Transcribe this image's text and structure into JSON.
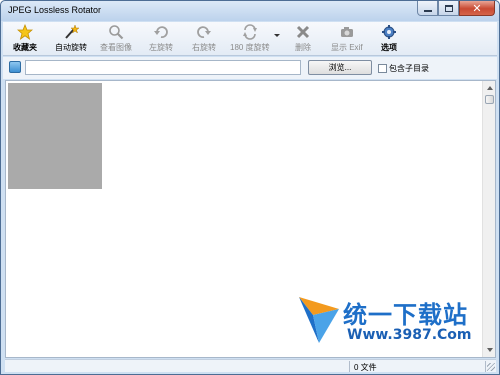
{
  "window": {
    "title": "JPEG Lossless Rotator"
  },
  "toolbar": {
    "items": [
      {
        "label": "收藏夹",
        "icon": "star-icon",
        "enabled": true
      },
      {
        "label": "自动旋转",
        "icon": "magic-wand-icon",
        "enabled": true
      },
      {
        "label": "查看图像",
        "icon": "magnifier-icon",
        "enabled": false
      },
      {
        "label": "左旋转",
        "icon": "rotate-left-icon",
        "enabled": false
      },
      {
        "label": "右旋转",
        "icon": "rotate-right-icon",
        "enabled": false
      },
      {
        "label": "180 度旋转",
        "icon": "rotate-180-icon",
        "enabled": false
      },
      {
        "label": "删除",
        "icon": "delete-icon",
        "enabled": false
      },
      {
        "label": "显示 Exif",
        "icon": "camera-icon",
        "enabled": false
      },
      {
        "label": "选项",
        "icon": "options-icon",
        "enabled": true
      }
    ]
  },
  "pathbar": {
    "path_value": "",
    "browse_label": "浏览...",
    "include_subdirs_label": "包含子目录",
    "include_subdirs_checked": false
  },
  "watermark": {
    "brand": "统一下载站",
    "url": "Www.3987.Com"
  },
  "status": {
    "file_count": "0 文件"
  },
  "colors": {
    "chrome": "#cfe0f2",
    "thumbnail_placeholder": "#aaaaaa",
    "watermark_blue": "#1e6fc8",
    "watermark_orange": "#f39a1e"
  }
}
